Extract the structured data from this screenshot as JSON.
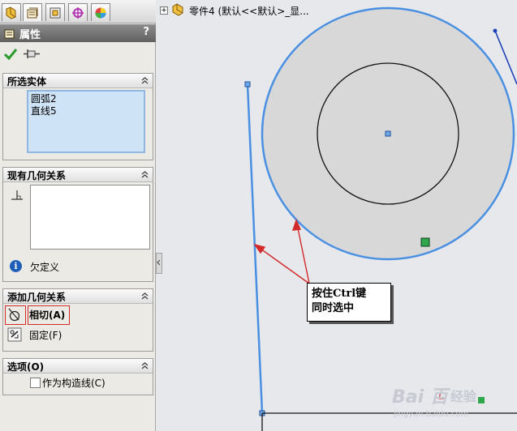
{
  "panel": {
    "title": "属性",
    "help": "?",
    "tabs": [
      "feature-manager",
      "property-manager",
      "configuration-manager",
      "dimxpert-manager",
      "display-manager"
    ],
    "selected_entities": {
      "header": "所选实体",
      "items": [
        "圆弧2",
        "直线5"
      ]
    },
    "existing_relations": {
      "header": "现有几何关系",
      "status": "欠定义"
    },
    "add_relations": {
      "header": "添加几何关系",
      "tangent_label": "相切(A)",
      "fix_label": "固定(F)"
    },
    "options": {
      "header": "选项(O)",
      "construction_label": "作为构造线(C)",
      "construction_checked": false
    }
  },
  "graphics": {
    "tree_root_label": "零件4 (默认<<默认>_显...",
    "callout_text_line1": "按住Ctrl键",
    "callout_text_line2": "同时选中"
  },
  "watermark": {
    "logo": "Bai 百",
    "brand": "经验",
    "url": "jingyan.baidu.com"
  },
  "colors": {
    "selection_blue": "#4a90e2",
    "circle_fill": "#d8d8d8",
    "annotation_red": "#d32a2a",
    "panel_bg": "#eceae4"
  }
}
